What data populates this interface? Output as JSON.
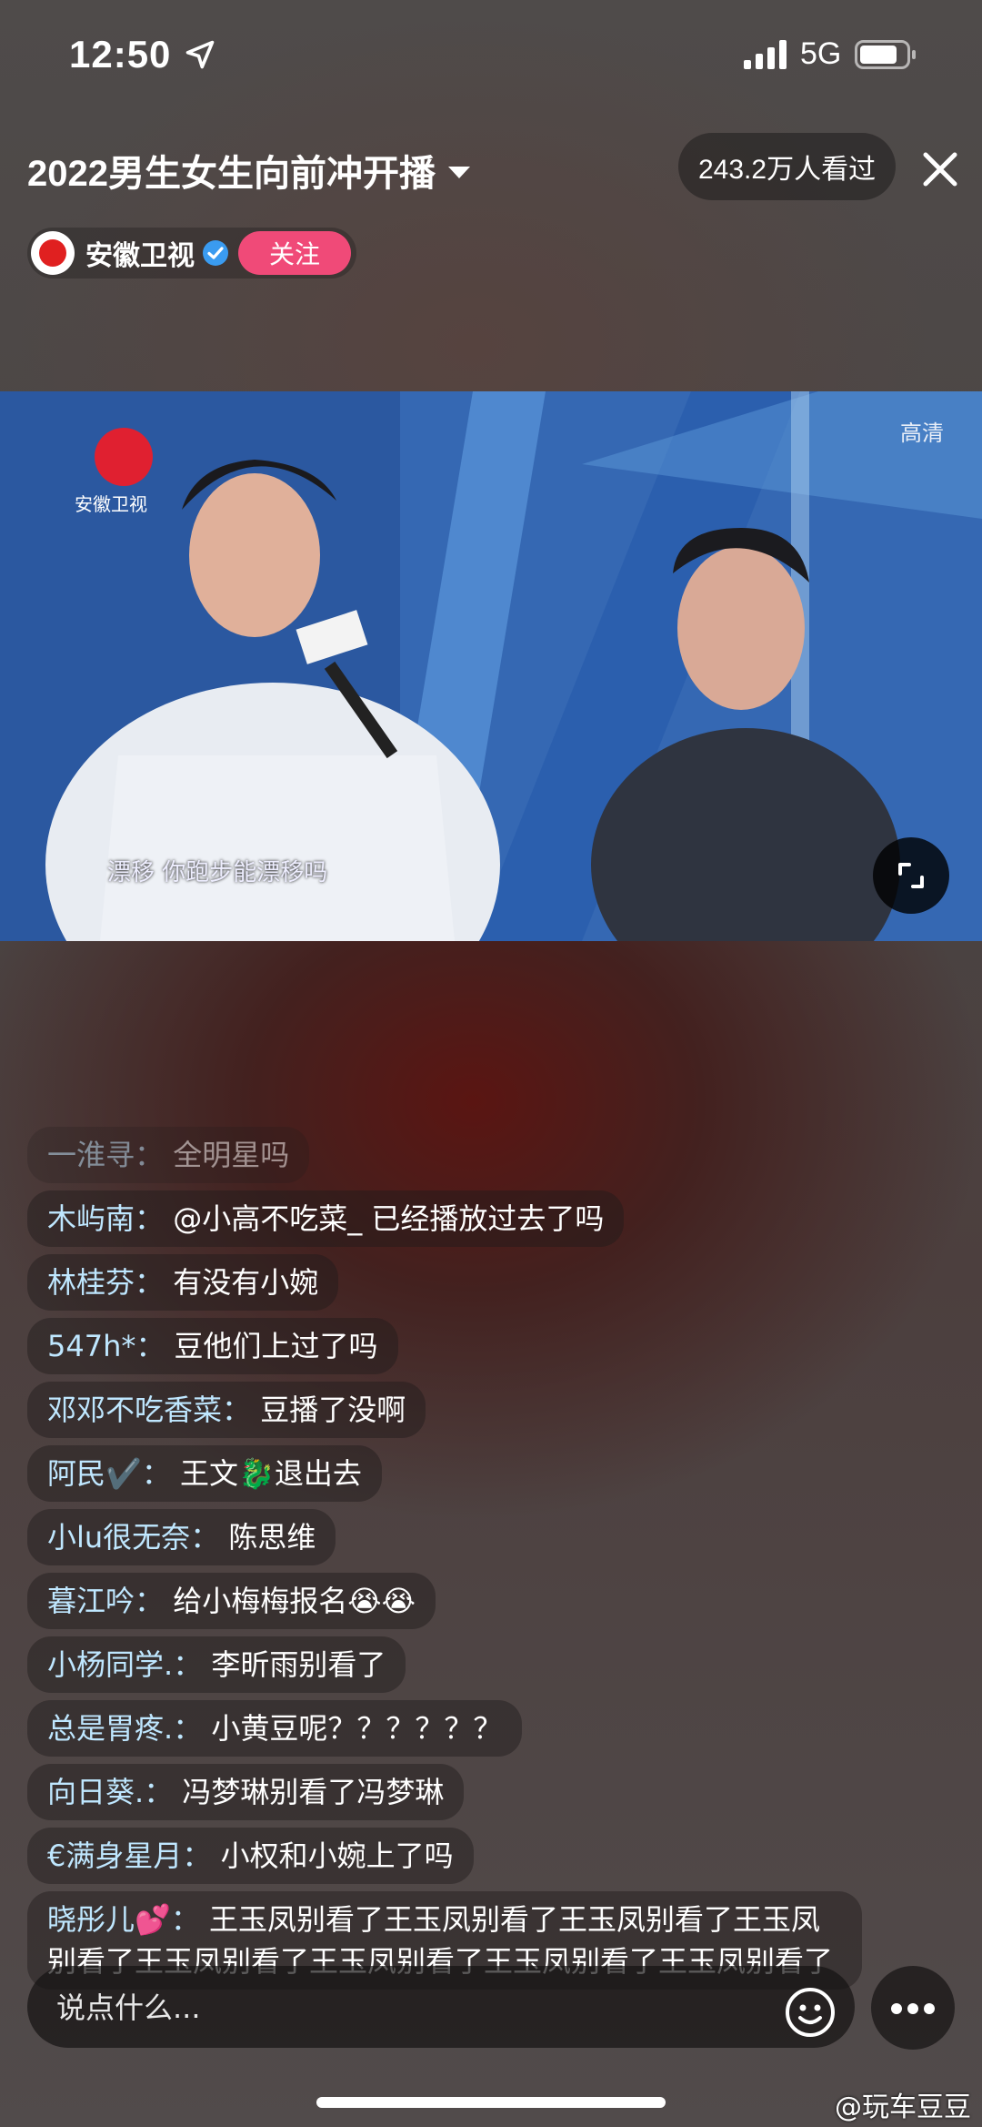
{
  "status_bar": {
    "time": "12:50",
    "network": "5G"
  },
  "header": {
    "title": "2022男生女生向前冲开播",
    "viewers": "243.2万人看过"
  },
  "channel": {
    "name": "安徽卫视",
    "follow_label": "关注"
  },
  "video": {
    "quality": "高清",
    "logo_text": "安徽卫视",
    "subtitle": "漂移 你跑步能漂移吗"
  },
  "chat": [
    {
      "user": "一淮寻",
      "text": "全明星吗",
      "faded": true
    },
    {
      "user": "木屿南",
      "text": "@小高不吃菜_ 已经播放过去了吗"
    },
    {
      "user": "林桂芬",
      "text": "有没有小婉"
    },
    {
      "user": "547h*",
      "text": "豆他们上过了吗"
    },
    {
      "user": "邓邓不吃香菜",
      "text": "豆播了没啊"
    },
    {
      "user": "阿民✔️",
      "text": "王文🐉退出去"
    },
    {
      "user": "小lu很无奈",
      "text": "陈思维"
    },
    {
      "user": "暮江吟",
      "text": "给小梅梅报名😭😭"
    },
    {
      "user": "小杨同学.",
      "text": "李昕雨别看了"
    },
    {
      "user": "总是胃疼.",
      "text": "小黄豆呢？？？？？？"
    },
    {
      "user": "向日葵.",
      "text": "冯梦琳别看了冯梦琳"
    },
    {
      "user": "€满身星月",
      "text": "小权和小婉上了吗"
    },
    {
      "user": "晓彤儿💕",
      "text": "王玉凤别看了王玉凤别看了王玉凤别看了王玉凤别看了王玉凤别看了王玉凤别看了王玉凤别看了王玉凤别看了"
    }
  ],
  "input": {
    "placeholder": "说点什么..."
  },
  "watermark": "@玩车豆豆",
  "colors": {
    "follow": "#f04a78",
    "username": "#bfe7ff"
  },
  "icons": [
    "location-arrow-icon",
    "signal-icon",
    "battery-icon",
    "caret-down-icon",
    "close-icon",
    "verified-icon",
    "expand-icon",
    "emoji-icon",
    "more-icon"
  ]
}
